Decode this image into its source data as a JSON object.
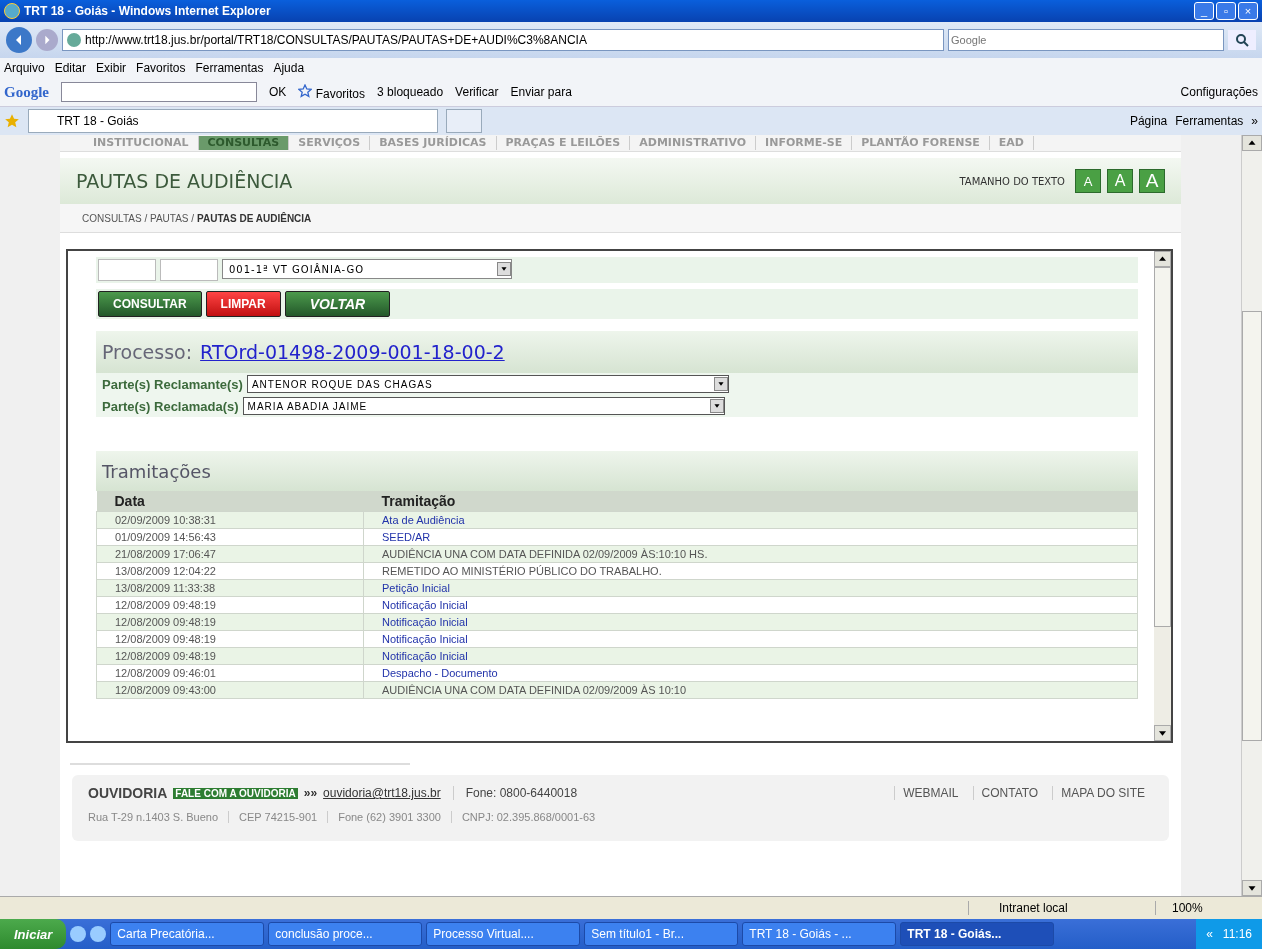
{
  "window": {
    "title": "TRT 18 - Goiás - Windows Internet Explorer",
    "controls": [
      "_",
      "▫",
      "×"
    ]
  },
  "address_bar": {
    "url": "http://www.trt18.jus.br/portal/TRT18/CONSULTAS/PAUTAS/PAUTAS+DE+AUDI%C3%8ANCIA",
    "search_placeholder": "Google"
  },
  "menu": [
    "Arquivo",
    "Editar",
    "Exibir",
    "Favoritos",
    "Ferramentas",
    "Ajuda"
  ],
  "google_toolbar": {
    "logo": "Google",
    "ok": "OK",
    "favoritos": "Favoritos",
    "bloqueado": "3 bloqueado",
    "verificar": "Verificar",
    "enviar": "Enviar para",
    "config": "Configurações"
  },
  "tab_bar": {
    "tab": "TRT 18 - Goiás",
    "pagina": "Página",
    "ferramentas": "Ferramentas",
    "more": "»"
  },
  "site_nav": [
    {
      "label": "INSTITUCIONAL",
      "selected": false
    },
    {
      "label": "CONSULTAS",
      "selected": true
    },
    {
      "label": "SERVIÇOS",
      "selected": false
    },
    {
      "label": "BASES JURÍDICAS",
      "selected": false
    },
    {
      "label": "PRAÇAS E LEILÕES",
      "selected": false
    },
    {
      "label": "ADMINISTRATIVO",
      "selected": false
    },
    {
      "label": "INFORME-SE",
      "selected": false
    },
    {
      "label": "PLANTÃO FORENSE",
      "selected": false
    },
    {
      "label": "EAD",
      "selected": false
    }
  ],
  "header": {
    "title": "PAUTAS DE AUDIÊNCIA",
    "text_size_label": "TAMANHO DO TEXTO",
    "size_buttons": [
      "A",
      "A",
      "A"
    ]
  },
  "breadcrumb": {
    "path": "CONSULTAS / PAUTAS / ",
    "current": "PAUTAS DE AUDIÊNCIA"
  },
  "form": {
    "vara": "001-1ª VT GOIÂNIA-GO",
    "buttons": [
      {
        "label": "CONSULTAR",
        "kind": "green"
      },
      {
        "label": "LIMPAR",
        "kind": "red"
      },
      {
        "label": "VOLTAR",
        "kind": "italic"
      }
    ]
  },
  "processo": {
    "label": "Processo:",
    "number": "RTOrd-01498-2009-001-18-00-2"
  },
  "partes": [
    {
      "label": "Parte(s) Reclamante(s)",
      "value": "ANTENOR ROQUE DAS CHAGAS"
    },
    {
      "label": "Parte(s) Reclamada(s)",
      "value": "MARIA ABADIA JAIME"
    }
  ],
  "tramitacoes": {
    "title": "Tramitações",
    "columns": [
      "Data",
      "Tramitação"
    ],
    "rows": [
      {
        "date": "02/09/2009 10:38:31",
        "text": "Ata de Audiência",
        "kind": "link"
      },
      {
        "date": "01/09/2009 14:56:43",
        "text": "SEED/AR",
        "kind": "link"
      },
      {
        "date": "21/08/2009 17:06:47",
        "text": "AUDIÊNCIA UNA COM DATA DEFINIDA 02/09/2009 ÀS:10:10 HS.",
        "kind": "plain"
      },
      {
        "date": "13/08/2009 12:04:22",
        "text": "REMETIDO AO MINISTÉRIO PÚBLICO DO TRABALHO.",
        "kind": "plain"
      },
      {
        "date": "13/08/2009 11:33:38",
        "text": "Petição Inicial",
        "kind": "link"
      },
      {
        "date": "12/08/2009 09:48:19",
        "text": "Notificação Inicial",
        "kind": "link"
      },
      {
        "date": "12/08/2009 09:48:19",
        "text": "Notificação Inicial",
        "kind": "link"
      },
      {
        "date": "12/08/2009 09:48:19",
        "text": "Notificação Inicial",
        "kind": "link"
      },
      {
        "date": "12/08/2009 09:48:19",
        "text": "Notificação Inicial",
        "kind": "link"
      },
      {
        "date": "12/08/2009 09:46:01",
        "text": "Despacho - Documento",
        "kind": "link"
      },
      {
        "date": "12/08/2009 09:43:00",
        "text": "AUDIÊNCIA UNA COM DATA DEFINIDA 02/09/2009 ÀS 10:10",
        "kind": "plain"
      }
    ]
  },
  "footer": {
    "ouvidoria": "OUVIDORIA",
    "fale": "FALE COM A OUVIDORIA",
    "arrows": "»»",
    "email": "ouvidoria@trt18.jus.br",
    "fone": "Fone: 0800-6440018",
    "links": [
      "WEBMAIL",
      "CONTATO",
      "MAPA DO SITE"
    ],
    "address": [
      "Rua T-29 n.1403 S. Bueno",
      "CEP 74215-901",
      "Fone (62) 3901 3300",
      "CNPJ: 02.395.868/0001-63"
    ]
  },
  "status_bar": {
    "zone": "Intranet local",
    "zoom": "100%"
  },
  "taskbar": {
    "start": "Iniciar",
    "tasks": [
      {
        "label": "Carta Precatória...",
        "selected": false
      },
      {
        "label": "conclusão proce...",
        "selected": false
      },
      {
        "label": "Processo Virtual....",
        "selected": false
      },
      {
        "label": "Sem título1 - Br...",
        "selected": false
      },
      {
        "label": "TRT 18 - Goiás - ...",
        "selected": false
      },
      {
        "label": "TRT 18 - Goiás...",
        "selected": true
      }
    ],
    "clock": "11:16",
    "chevron": "«"
  }
}
